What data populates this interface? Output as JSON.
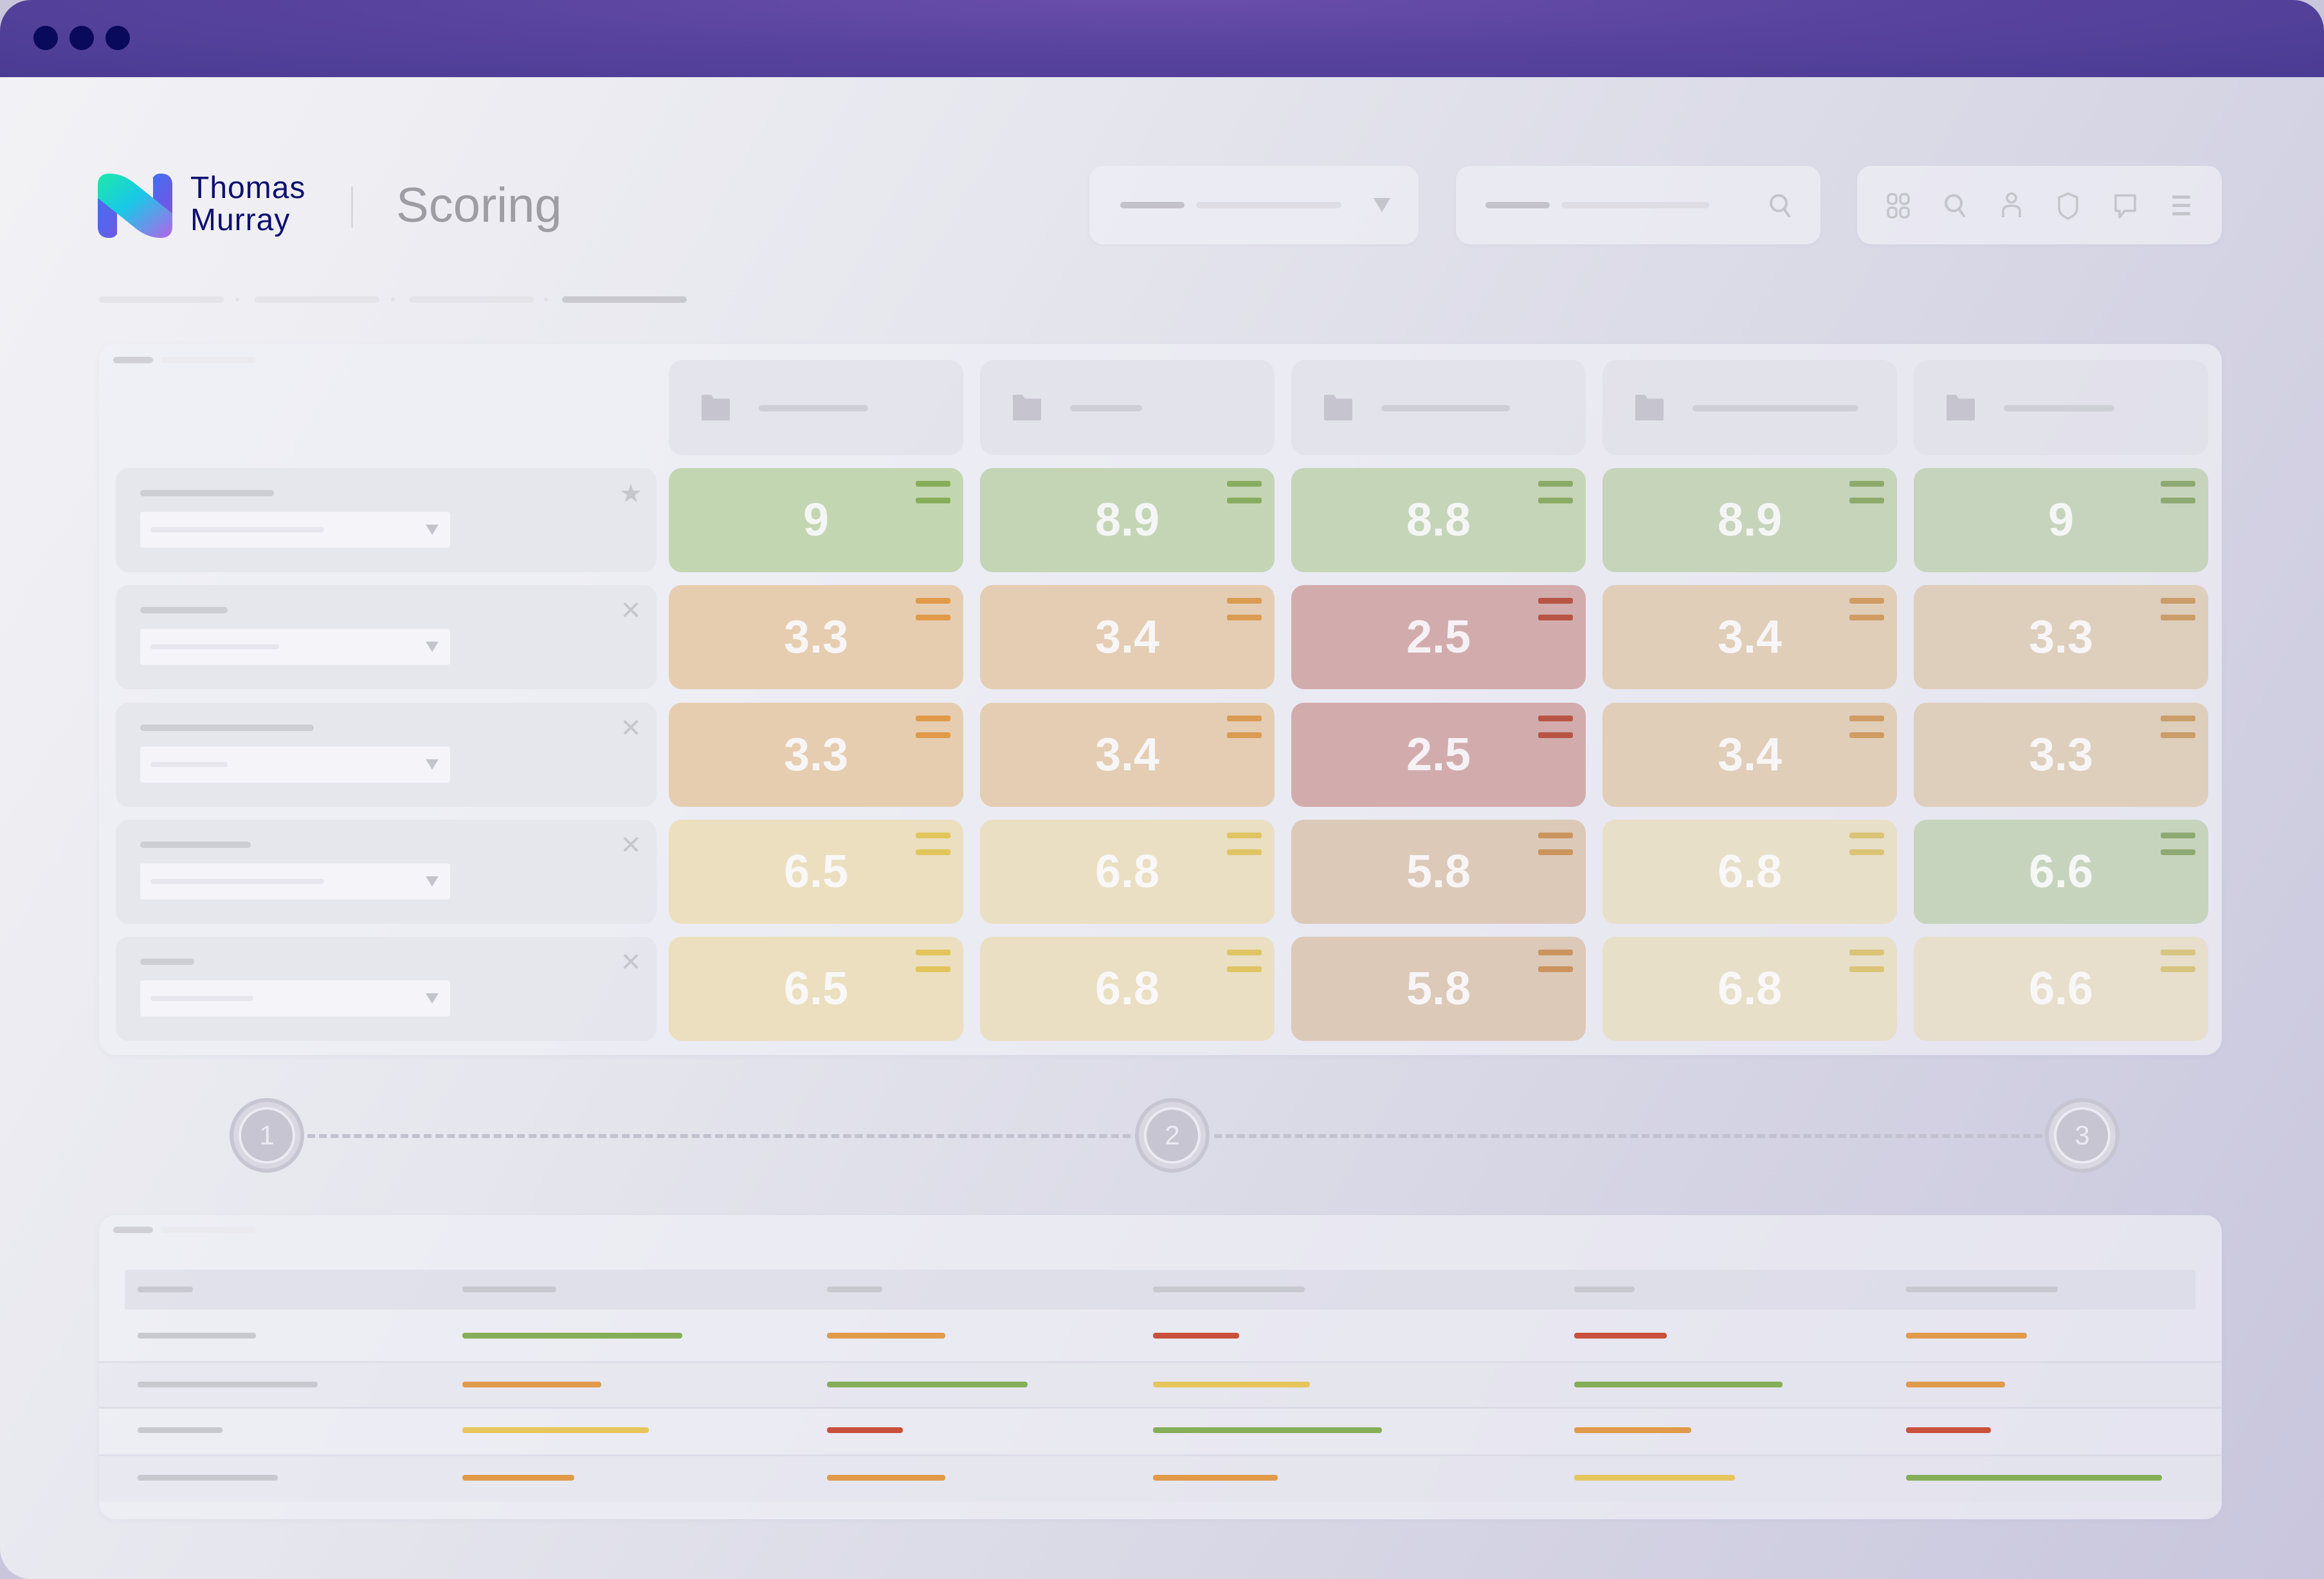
{
  "window": {
    "controls": [
      "close",
      "minimize",
      "maximize"
    ],
    "colors": {
      "titlebar": "#5a45a0",
      "dots": "#0a0a5c"
    }
  },
  "header": {
    "brand_line1": "Thomas",
    "brand_line2": "Murray",
    "page_title": "Scoring",
    "filter_dropdown": {
      "icon": "caret-down-icon"
    },
    "search": {
      "icon": "search-icon"
    },
    "toolbar_icons": [
      "grid-icon",
      "search-icon",
      "user-icon",
      "shield-icon",
      "chat-icon",
      "menu-icon"
    ]
  },
  "breadcrumb": {
    "levels": 4
  },
  "scoring_matrix": {
    "columns": [
      {
        "icon": "folder-icon"
      },
      {
        "icon": "folder-icon"
      },
      {
        "icon": "folder-icon"
      },
      {
        "icon": "folder-icon"
      },
      {
        "icon": "folder-icon"
      }
    ],
    "rows": [
      {
        "action_icon": "star-icon",
        "action_glyph": "★",
        "scores": [
          {
            "value": "9",
            "level": "good"
          },
          {
            "value": "8.9",
            "level": "good"
          },
          {
            "value": "8.8",
            "level": "good"
          },
          {
            "value": "8.9",
            "level": "good"
          },
          {
            "value": "9",
            "level": "good"
          }
        ]
      },
      {
        "action_icon": "close-icon",
        "action_glyph": "✕",
        "scores": [
          {
            "value": "3.3",
            "level": "low"
          },
          {
            "value": "3.4",
            "level": "low"
          },
          {
            "value": "2.5",
            "level": "poor"
          },
          {
            "value": "3.4",
            "level": "low"
          },
          {
            "value": "3.3",
            "level": "low"
          }
        ]
      },
      {
        "action_icon": "close-icon",
        "action_glyph": "✕",
        "scores": [
          {
            "value": "3.3",
            "level": "low"
          },
          {
            "value": "3.4",
            "level": "low"
          },
          {
            "value": "2.5",
            "level": "poor"
          },
          {
            "value": "3.4",
            "level": "low"
          },
          {
            "value": "3.3",
            "level": "low"
          }
        ]
      },
      {
        "action_icon": "close-icon",
        "action_glyph": "✕",
        "scores": [
          {
            "value": "6.5",
            "level": "mid"
          },
          {
            "value": "6.8",
            "level": "mid"
          },
          {
            "value": "5.8",
            "level": "lowmid"
          },
          {
            "value": "6.8",
            "level": "mid"
          },
          {
            "value": "6.6",
            "level": "good"
          }
        ]
      },
      {
        "action_icon": "close-icon",
        "action_glyph": "✕",
        "scores": [
          {
            "value": "6.5",
            "level": "mid"
          },
          {
            "value": "6.8",
            "level": "mid"
          },
          {
            "value": "5.8",
            "level": "lowmid"
          },
          {
            "value": "6.8",
            "level": "mid"
          },
          {
            "value": "6.6",
            "level": "mid"
          }
        ]
      }
    ],
    "level_colors": {
      "good": {
        "bg": "#c3d6b2",
        "mark": "#86ae58"
      },
      "low": {
        "bg": "#e6cdb0",
        "mark": "#e09a4a"
      },
      "poor": {
        "bg": "#d9aaaa",
        "mark": "#c9503c"
      },
      "mid": {
        "bg": "#ebdfbf",
        "mark": "#e2c45a"
      },
      "lowmid": {
        "bg": "#e0c8b4",
        "mark": "#d6924e"
      }
    }
  },
  "stepper": {
    "steps": [
      {
        "label": "1"
      },
      {
        "label": "2"
      },
      {
        "label": "3"
      }
    ]
  },
  "summary_table": {
    "columns": 6,
    "status_colors": {
      "green": "#86ae58",
      "orange": "#e09a4a",
      "yellow": "#e6c65c",
      "red": "#c9503c"
    },
    "rows": [
      [
        "gray",
        "green",
        "orange",
        "red",
        "red",
        "orange"
      ],
      [
        "gray",
        "orange",
        "green",
        "yellow",
        "green",
        "orange"
      ],
      [
        "gray",
        "yellow",
        "red",
        "green",
        "orange",
        "red"
      ],
      [
        "gray",
        "orange",
        "orange",
        "orange",
        "yellow",
        "green"
      ]
    ]
  }
}
